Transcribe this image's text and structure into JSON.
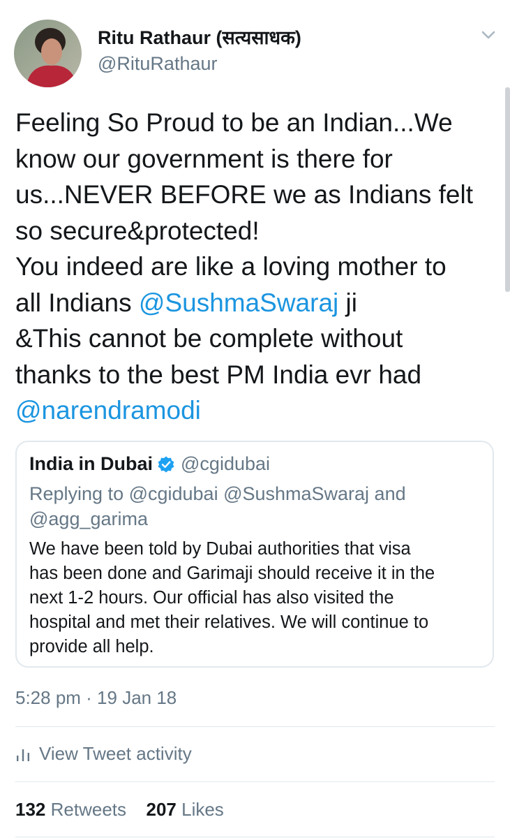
{
  "author": {
    "name": "Ritu Rathaur (सत्यसाधक)",
    "handle": "@RituRathaur"
  },
  "tweet": {
    "lines": [
      [
        {
          "text": "Feeling So Proud to be an Indian...We"
        }
      ],
      [
        {
          "text": "know our government is there for"
        }
      ],
      [
        {
          "text": "us...NEVER BEFORE we as Indians felt"
        }
      ],
      [
        {
          "text": "so secure&protected!"
        }
      ],
      [
        {
          "text": "You indeed are like a loving mother to"
        }
      ],
      [
        {
          "text": "all Indians "
        },
        {
          "text": "@SushmaSwaraj",
          "mention": true
        },
        {
          "text": " ji"
        }
      ],
      [
        {
          "text": "&This cannot be complete without"
        }
      ],
      [
        {
          "text": "thanks to the best PM India evr had"
        }
      ],
      [
        {
          "text": "@narendramodi",
          "mention": true
        }
      ]
    ]
  },
  "quoted": {
    "name": "India in Dubai",
    "handle": "@cgidubai",
    "reply_line1": "Replying to @cgidubai @SushmaSwaraj and",
    "reply_line2": "@agg_garima",
    "body_lines": [
      "We have been told by Dubai authorities that visa",
      "has been done and Garimaji should receive it in the",
      "next 1-2 hours. Our official has also visited the",
      "hospital and met their relatives. We will continue to",
      "provide all help."
    ]
  },
  "timestamp": "5:28 pm · 19 Jan 18",
  "activity_label": "View Tweet activity",
  "stats": {
    "retweets_count": "132",
    "retweets_label": "Retweets",
    "likes_count": "207",
    "likes_label": "Likes"
  },
  "colors": {
    "mention": "#1b95e0",
    "secondary_text": "#657786",
    "verified": "#1da1f2"
  },
  "icons": [
    "chevron-down-icon",
    "verified-badge-icon",
    "analytics-bar-icon"
  ]
}
